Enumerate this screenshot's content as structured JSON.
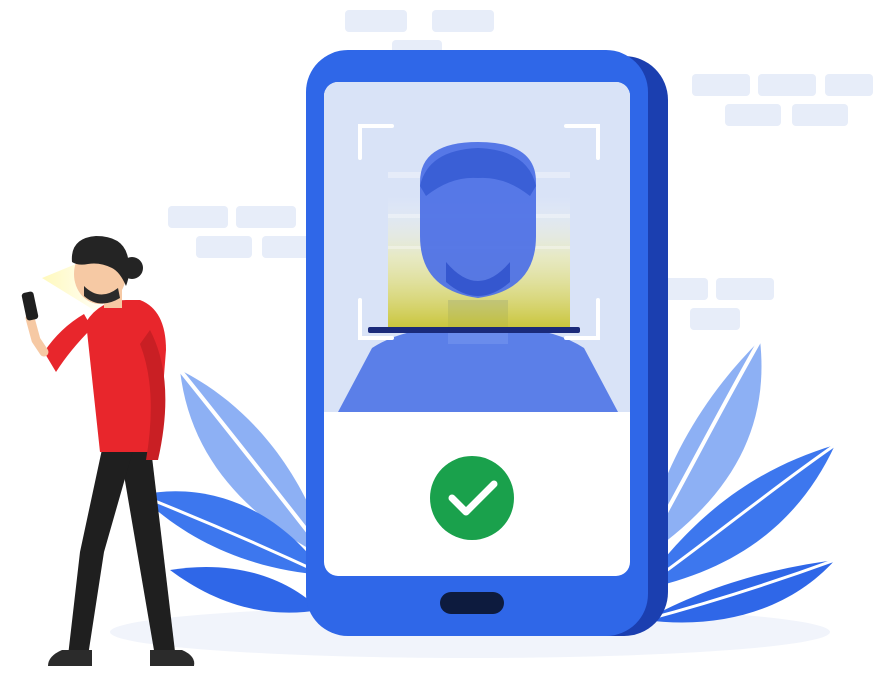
{
  "illustration": {
    "subject": "face-recognition-verification",
    "status_icon": "checkmark-icon",
    "colors": {
      "phone_body": "#2f67e8",
      "phone_shadow": "#1b3fb0",
      "screen_top": "#dbe5f8",
      "screen_bottom": "#ffffff",
      "face": "#4f72e6",
      "scan_glow": "#d8d23a",
      "scan_line": "#1a2a7a",
      "check_circle": "#1aa14c",
      "leaves_light": "#8fb1f4",
      "leaves_dark": "#3f78ee",
      "bricks": "#e6ecf9",
      "shirt": "#e8262c",
      "pants": "#1f1f1f",
      "hair": "#242424",
      "skin": "#f6c9a4"
    }
  }
}
